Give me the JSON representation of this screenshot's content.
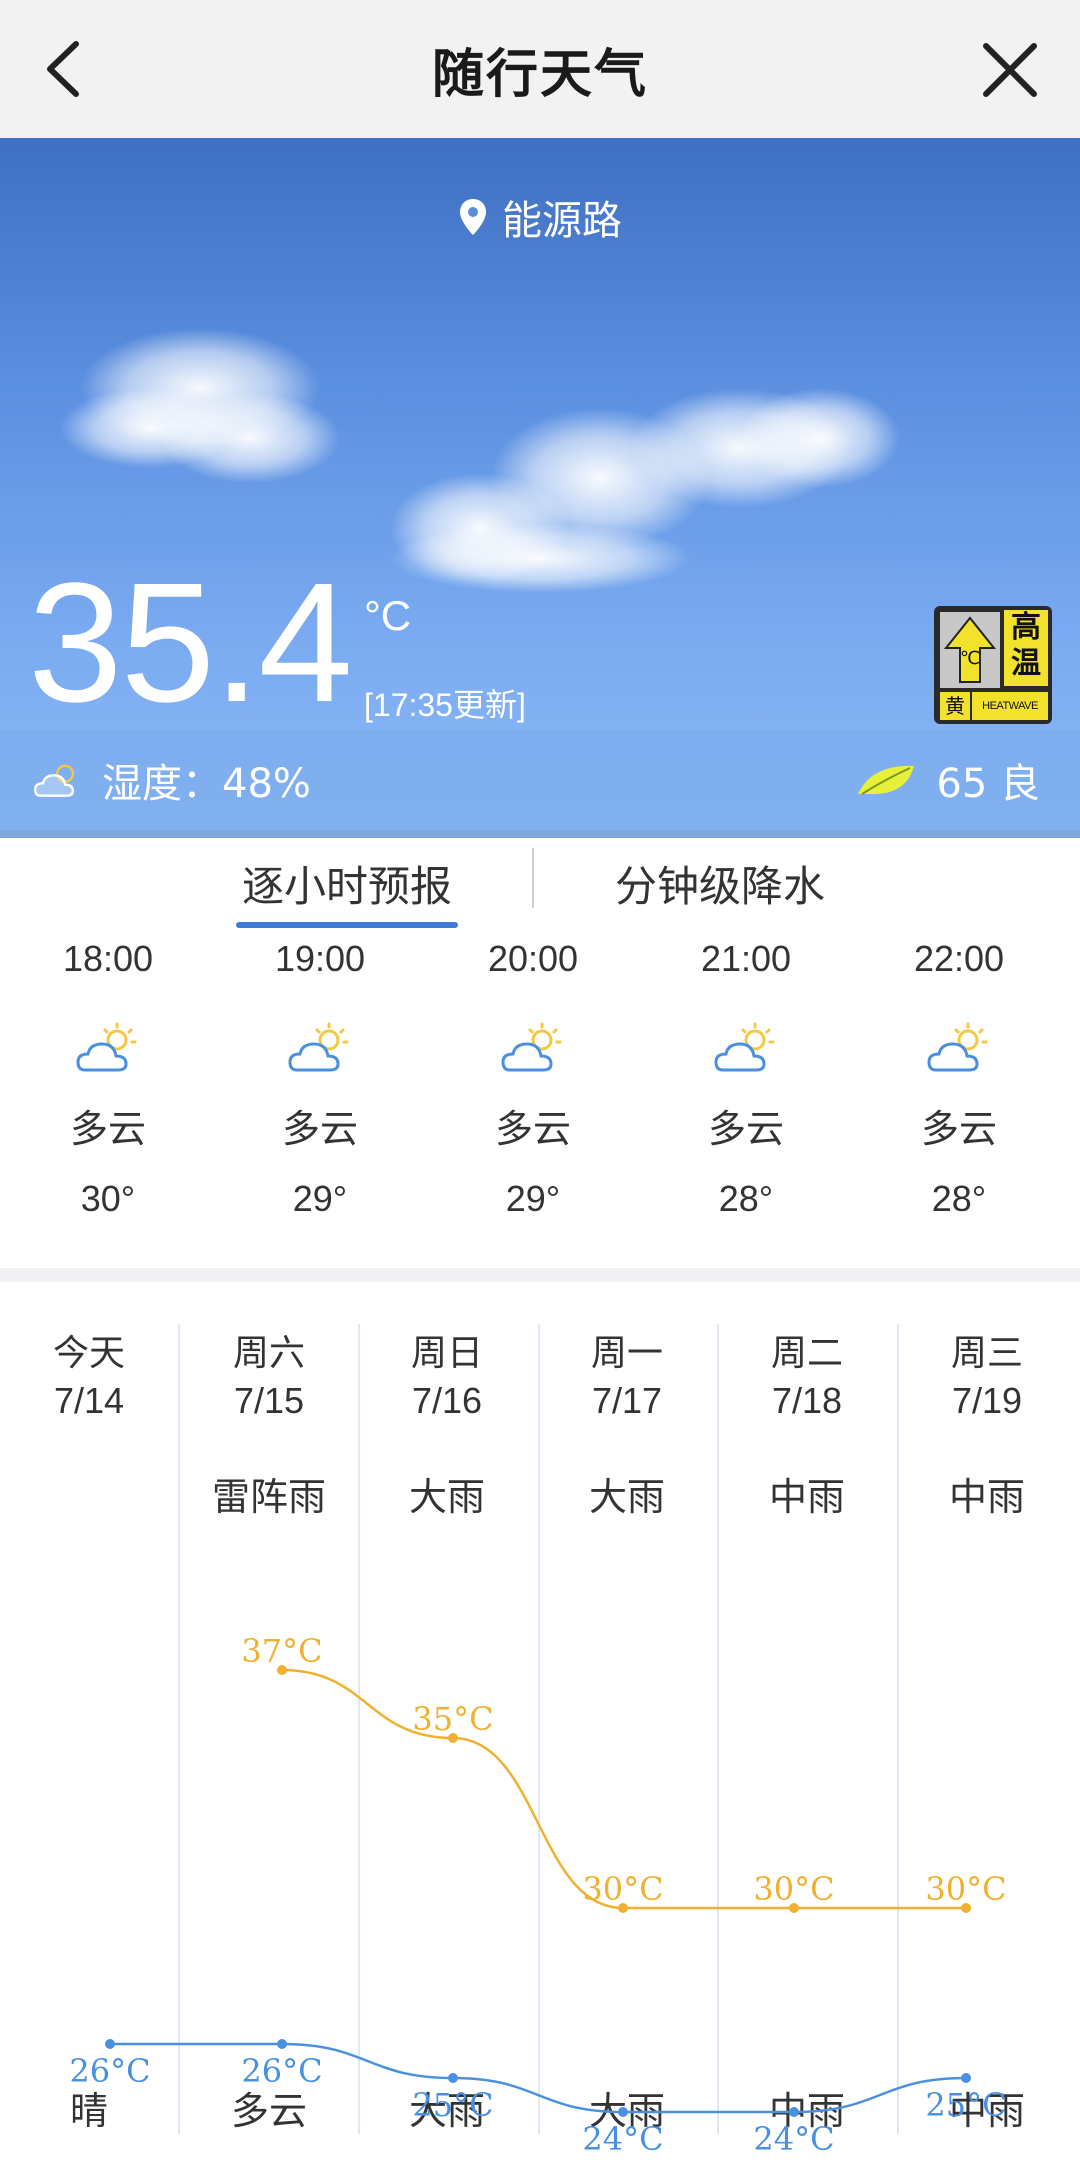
{
  "header": {
    "title": "随行天气",
    "back_icon": "back-chevron-icon",
    "close_icon": "close-icon"
  },
  "hero": {
    "location": "能源路",
    "temperature": "35.4",
    "unit": "°C",
    "updated": "[17:35更新]",
    "humidity": "湿度：48%",
    "aqi": "65 良",
    "warning": {
      "char": "高温",
      "level": "黄",
      "en": "HEATWAVE",
      "icon_char": "℃"
    }
  },
  "tabs": {
    "hourly": "逐小时预报",
    "minute": "分钟级降水"
  },
  "hourly": [
    {
      "time": "18:00",
      "cond": "多云",
      "temp": "30°"
    },
    {
      "time": "19:00",
      "cond": "多云",
      "temp": "29°"
    },
    {
      "time": "20:00",
      "cond": "多云",
      "temp": "29°"
    },
    {
      "time": "21:00",
      "cond": "多云",
      "temp": "28°"
    },
    {
      "time": "22:00",
      "cond": "多云",
      "temp": "28°"
    }
  ],
  "daily": [
    {
      "day": "今天",
      "date": "7/14",
      "day_weather": "",
      "night_weather": "晴",
      "high": null,
      "low": 26
    },
    {
      "day": "周六",
      "date": "7/15",
      "day_weather": "雷阵雨",
      "night_weather": "多云",
      "high": 37,
      "low": 26
    },
    {
      "day": "周日",
      "date": "7/16",
      "day_weather": "大雨",
      "night_weather": "大雨",
      "high": 35,
      "low": 25
    },
    {
      "day": "周一",
      "date": "7/17",
      "day_weather": "大雨",
      "night_weather": "大雨",
      "high": 30,
      "low": 24
    },
    {
      "day": "周二",
      "date": "7/18",
      "day_weather": "中雨",
      "night_weather": "中雨",
      "high": 30,
      "low": 24
    },
    {
      "day": "周三",
      "date": "7/19",
      "day_weather": "中雨",
      "night_weather": "中雨",
      "high": 30,
      "low": 25
    }
  ],
  "chart_data": {
    "type": "line",
    "categories": [
      "7/14",
      "7/15",
      "7/16",
      "7/17",
      "7/18",
      "7/19"
    ],
    "series": [
      {
        "values": [
          null,
          37,
          35,
          30,
          30,
          30
        ],
        "color": "#f0b030"
      },
      {
        "values": [
          26,
          26,
          25,
          24,
          24,
          25
        ],
        "color": "#4a90e0"
      }
    ],
    "unit": "°C"
  },
  "colors": {
    "accent": "#3f7bd6",
    "high": "#f0b030",
    "low": "#4a90e0"
  }
}
